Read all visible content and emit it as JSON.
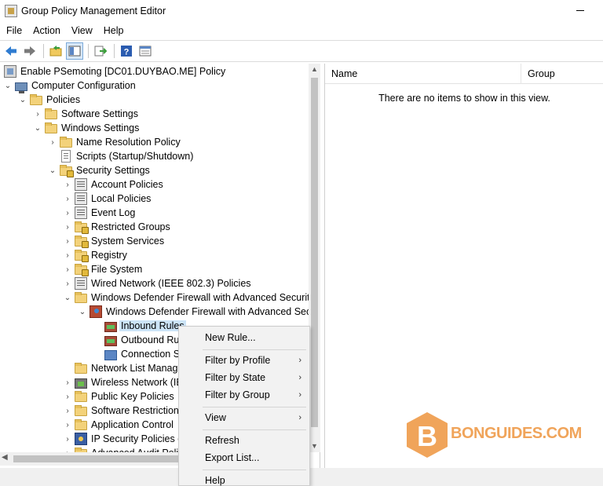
{
  "window": {
    "title": "Group Policy Management Editor"
  },
  "menubar": {
    "items": [
      "File",
      "Action",
      "View",
      "Help"
    ]
  },
  "toolbar": {
    "buttons": [
      "back-arrow-icon",
      "forward-arrow-icon",
      "up-folder-icon",
      "show-hide-tree-icon",
      "export-list-icon",
      "help-icon",
      "properties-icon"
    ]
  },
  "tree": {
    "items": [
      {
        "label": "Enable PSemoting [DC01.DUYBAO.ME] Policy",
        "icon": "policy-root-icon"
      },
      {
        "label": "Computer Configuration",
        "icon": "computer-icon"
      },
      {
        "label": "Policies",
        "icon": "folder-icon"
      },
      {
        "label": "Software Settings",
        "icon": "folder-icon"
      },
      {
        "label": "Windows Settings",
        "icon": "folder-icon"
      },
      {
        "label": "Name Resolution Policy",
        "icon": "folder-icon"
      },
      {
        "label": "Scripts (Startup/Shutdown)",
        "icon": "document-icon"
      },
      {
        "label": "Security Settings",
        "icon": "security-icon"
      },
      {
        "label": "Account Policies",
        "icon": "policy-icon"
      },
      {
        "label": "Local Policies",
        "icon": "policy-icon"
      },
      {
        "label": "Event Log",
        "icon": "policy-icon"
      },
      {
        "label": "Restricted Groups",
        "icon": "locked-folder-icon"
      },
      {
        "label": "System Services",
        "icon": "locked-folder-icon"
      },
      {
        "label": "Registry",
        "icon": "locked-folder-icon"
      },
      {
        "label": "File System",
        "icon": "locked-folder-icon"
      },
      {
        "label": "Wired Network (IEEE 802.3) Policies",
        "icon": "network-icon"
      },
      {
        "label": "Windows Defender Firewall with Advanced Security",
        "icon": "folder-icon"
      },
      {
        "label": "Windows Defender Firewall with Advanced Secu",
        "icon": "firewall-icon"
      },
      {
        "label": "Inbound Rules",
        "icon": "rules-icon"
      },
      {
        "label": "Outbound Ru",
        "icon": "rules-icon"
      },
      {
        "label": "Connection S",
        "icon": "connection-icon"
      },
      {
        "label": "Network List Manag",
        "icon": "folder-icon"
      },
      {
        "label": "Wireless Network (IE",
        "icon": "wireless-icon"
      },
      {
        "label": "Public Key Policies",
        "icon": "folder-icon"
      },
      {
        "label": "Software Restriction",
        "icon": "folder-icon"
      },
      {
        "label": "Application Control",
        "icon": "folder-icon"
      },
      {
        "label": "IP Security Policies o",
        "icon": "ipsec-icon"
      },
      {
        "label": "Advanced Audit Poli",
        "icon": "folder-icon"
      }
    ]
  },
  "list": {
    "columns": [
      "Name",
      "Group"
    ],
    "empty_message": "There are no items to show in this view."
  },
  "context_menu": {
    "items": [
      {
        "label": "New Rule...",
        "submenu": false
      },
      {
        "label": "Filter by Profile",
        "submenu": true
      },
      {
        "label": "Filter by State",
        "submenu": true
      },
      {
        "label": "Filter by Group",
        "submenu": true
      },
      {
        "label": "View",
        "submenu": true
      },
      {
        "label": "Refresh",
        "submenu": false
      },
      {
        "label": "Export List...",
        "submenu": false
      },
      {
        "label": "Help",
        "submenu": false
      }
    ],
    "submenu_arrow": "›"
  },
  "watermark": {
    "letter": "B",
    "text": "BONGUIDES.COM",
    "color": "#f0a45a"
  }
}
